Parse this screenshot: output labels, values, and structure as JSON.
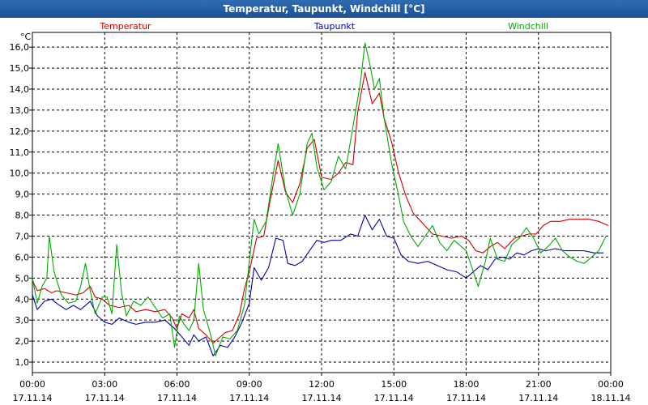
{
  "window": {
    "title": "Temperatur, Taupunkt, Windchill [°C]"
  },
  "chart_data": {
    "type": "line",
    "title": "Temperatur, Taupunkt, Windchill [°C]",
    "ylabel": "°C",
    "ylim": [
      0.5,
      16.7
    ],
    "yticks": [
      "1,0",
      "2,0",
      "3,0",
      "4,0",
      "5,0",
      "6,0",
      "7,0",
      "8,0",
      "9,0",
      "10,0",
      "11,0",
      "12,0",
      "13,0",
      "14,0",
      "15,0",
      "16,0"
    ],
    "ytick_values": [
      1,
      2,
      3,
      4,
      5,
      6,
      7,
      8,
      9,
      10,
      11,
      12,
      13,
      14,
      15,
      16
    ],
    "xlim": [
      0,
      24
    ],
    "xticks": [
      {
        "time": "00:00",
        "date": "17.11.14",
        "h": 0
      },
      {
        "time": "03:00",
        "date": "17.11.14",
        "h": 3
      },
      {
        "time": "06:00",
        "date": "17.11.14",
        "h": 6
      },
      {
        "time": "09:00",
        "date": "17.11.14",
        "h": 9
      },
      {
        "time": "12:00",
        "date": "17.11.14",
        "h": 12
      },
      {
        "time": "15:00",
        "date": "17.11.14",
        "h": 15
      },
      {
        "time": "18:00",
        "date": "17.11.14",
        "h": 18
      },
      {
        "time": "21:00",
        "date": "17.11.14",
        "h": 21
      },
      {
        "time": "00:00",
        "date": "18.11.14",
        "h": 24
      }
    ],
    "grid": true,
    "series": [
      {
        "name": "Temperatur",
        "color": "#cc0000",
        "points": [
          [
            0,
            4.9
          ],
          [
            0.2,
            4.4
          ],
          [
            0.5,
            4.5
          ],
          [
            0.8,
            4.3
          ],
          [
            1.0,
            4.4
          ],
          [
            1.4,
            4.3
          ],
          [
            1.8,
            4.2
          ],
          [
            2.1,
            4.3
          ],
          [
            2.4,
            4.6
          ],
          [
            2.6,
            4.1
          ],
          [
            2.9,
            4.0
          ],
          [
            3.2,
            3.7
          ],
          [
            3.6,
            3.6
          ],
          [
            4.0,
            3.7
          ],
          [
            4.3,
            3.4
          ],
          [
            4.7,
            3.5
          ],
          [
            5.1,
            3.4
          ],
          [
            5.5,
            3.5
          ],
          [
            5.8,
            3.1
          ],
          [
            6.0,
            2.6
          ],
          [
            6.2,
            3.3
          ],
          [
            6.5,
            3.1
          ],
          [
            6.7,
            3.5
          ],
          [
            6.9,
            2.6
          ],
          [
            7.2,
            2.3
          ],
          [
            7.5,
            1.9
          ],
          [
            7.7,
            2.1
          ],
          [
            8.0,
            2.4
          ],
          [
            8.3,
            2.5
          ],
          [
            8.6,
            3.3
          ],
          [
            8.8,
            4.5
          ],
          [
            9.0,
            5.3
          ],
          [
            9.3,
            6.9
          ],
          [
            9.6,
            7.0
          ],
          [
            9.9,
            8.9
          ],
          [
            10.2,
            10.6
          ],
          [
            10.5,
            9.1
          ],
          [
            10.8,
            8.6
          ],
          [
            11.1,
            9.5
          ],
          [
            11.4,
            11.2
          ],
          [
            11.7,
            11.6
          ],
          [
            12.0,
            9.8
          ],
          [
            12.4,
            9.7
          ],
          [
            12.7,
            10.0
          ],
          [
            13.0,
            10.5
          ],
          [
            13.3,
            10.4
          ],
          [
            13.5,
            12.9
          ],
          [
            13.8,
            14.8
          ],
          [
            14.1,
            13.3
          ],
          [
            14.4,
            13.8
          ],
          [
            14.6,
            12.6
          ],
          [
            14.9,
            11.5
          ],
          [
            15.2,
            10.0
          ],
          [
            15.5,
            8.9
          ],
          [
            15.8,
            8.1
          ],
          [
            16.2,
            7.6
          ],
          [
            16.6,
            7.1
          ],
          [
            17.0,
            7.0
          ],
          [
            17.4,
            6.9
          ],
          [
            17.8,
            7.0
          ],
          [
            18.1,
            6.8
          ],
          [
            18.4,
            6.3
          ],
          [
            18.7,
            6.2
          ],
          [
            19.0,
            6.5
          ],
          [
            19.3,
            6.7
          ],
          [
            19.6,
            6.4
          ],
          [
            20.0,
            6.9
          ],
          [
            20.3,
            7.0
          ],
          [
            20.6,
            7.1
          ],
          [
            20.9,
            7.1
          ],
          [
            21.2,
            7.5
          ],
          [
            21.5,
            7.7
          ],
          [
            21.9,
            7.7
          ],
          [
            22.3,
            7.8
          ],
          [
            22.7,
            7.8
          ],
          [
            23.1,
            7.8
          ],
          [
            23.5,
            7.7
          ],
          [
            23.9,
            7.5
          ]
        ]
      },
      {
        "name": "Taupunkt",
        "color": "#0000aa",
        "points": [
          [
            0,
            4.2
          ],
          [
            0.2,
            3.5
          ],
          [
            0.5,
            3.9
          ],
          [
            0.8,
            4.0
          ],
          [
            1.0,
            3.8
          ],
          [
            1.4,
            3.5
          ],
          [
            1.7,
            3.7
          ],
          [
            2.0,
            3.5
          ],
          [
            2.4,
            3.9
          ],
          [
            2.7,
            3.2
          ],
          [
            3.0,
            2.9
          ],
          [
            3.3,
            2.8
          ],
          [
            3.6,
            3.1
          ],
          [
            4.0,
            2.9
          ],
          [
            4.3,
            2.8
          ],
          [
            4.7,
            2.9
          ],
          [
            5.1,
            2.9
          ],
          [
            5.5,
            3.0
          ],
          [
            5.9,
            2.6
          ],
          [
            6.2,
            2.2
          ],
          [
            6.5,
            1.8
          ],
          [
            6.7,
            2.3
          ],
          [
            6.9,
            2.0
          ],
          [
            7.2,
            2.2
          ],
          [
            7.5,
            1.3
          ],
          [
            7.8,
            1.8
          ],
          [
            8.1,
            1.7
          ],
          [
            8.4,
            2.2
          ],
          [
            8.7,
            2.9
          ],
          [
            9.0,
            3.8
          ],
          [
            9.2,
            5.5
          ],
          [
            9.5,
            4.9
          ],
          [
            9.8,
            5.5
          ],
          [
            10.1,
            6.9
          ],
          [
            10.4,
            6.8
          ],
          [
            10.6,
            5.7
          ],
          [
            10.9,
            5.6
          ],
          [
            11.2,
            5.8
          ],
          [
            11.5,
            6.3
          ],
          [
            11.8,
            6.8
          ],
          [
            12.1,
            6.7
          ],
          [
            12.4,
            6.8
          ],
          [
            12.8,
            6.8
          ],
          [
            13.2,
            7.1
          ],
          [
            13.5,
            7.0
          ],
          [
            13.8,
            8.0
          ],
          [
            14.1,
            7.3
          ],
          [
            14.4,
            7.8
          ],
          [
            14.7,
            7.0
          ],
          [
            15.0,
            6.9
          ],
          [
            15.3,
            6.1
          ],
          [
            15.6,
            5.8
          ],
          [
            16.0,
            5.7
          ],
          [
            16.4,
            5.8
          ],
          [
            16.8,
            5.6
          ],
          [
            17.2,
            5.4
          ],
          [
            17.6,
            5.3
          ],
          [
            18.0,
            5.0
          ],
          [
            18.3,
            5.3
          ],
          [
            18.6,
            5.6
          ],
          [
            18.9,
            5.4
          ],
          [
            19.2,
            5.9
          ],
          [
            19.5,
            6.0
          ],
          [
            19.8,
            5.9
          ],
          [
            20.1,
            6.2
          ],
          [
            20.4,
            6.1
          ],
          [
            20.7,
            6.3
          ],
          [
            21.0,
            6.4
          ],
          [
            21.3,
            6.3
          ],
          [
            21.7,
            6.4
          ],
          [
            22.1,
            6.3
          ],
          [
            22.5,
            6.3
          ],
          [
            22.9,
            6.3
          ],
          [
            23.3,
            6.2
          ],
          [
            23.7,
            6.2
          ]
        ]
      },
      {
        "name": "Windchill",
        "color": "#00aa00",
        "points": [
          [
            0,
            5.0
          ],
          [
            0.2,
            3.8
          ],
          [
            0.4,
            4.6
          ],
          [
            0.6,
            5.0
          ],
          [
            0.7,
            7.0
          ],
          [
            0.9,
            5.3
          ],
          [
            1.2,
            4.2
          ],
          [
            1.5,
            3.8
          ],
          [
            1.8,
            3.9
          ],
          [
            2.0,
            4.6
          ],
          [
            2.2,
            5.7
          ],
          [
            2.4,
            4.4
          ],
          [
            2.6,
            3.3
          ],
          [
            2.9,
            4.1
          ],
          [
            3.1,
            4.1
          ],
          [
            3.3,
            3.3
          ],
          [
            3.5,
            6.6
          ],
          [
            3.7,
            4.3
          ],
          [
            3.9,
            3.2
          ],
          [
            4.2,
            3.9
          ],
          [
            4.5,
            3.7
          ],
          [
            4.8,
            4.1
          ],
          [
            5.1,
            3.6
          ],
          [
            5.4,
            3.1
          ],
          [
            5.7,
            3.3
          ],
          [
            5.9,
            1.7
          ],
          [
            6.1,
            3.2
          ],
          [
            6.3,
            2.8
          ],
          [
            6.5,
            2.5
          ],
          [
            6.7,
            3.0
          ],
          [
            6.9,
            5.7
          ],
          [
            7.1,
            3.5
          ],
          [
            7.4,
            2.3
          ],
          [
            7.6,
            1.3
          ],
          [
            7.9,
            2.2
          ],
          [
            8.2,
            2.1
          ],
          [
            8.5,
            2.5
          ],
          [
            8.8,
            3.7
          ],
          [
            9.0,
            5.8
          ],
          [
            9.2,
            7.8
          ],
          [
            9.4,
            7.1
          ],
          [
            9.7,
            7.7
          ],
          [
            10.0,
            10.0
          ],
          [
            10.2,
            11.4
          ],
          [
            10.5,
            9.2
          ],
          [
            10.8,
            8.0
          ],
          [
            11.1,
            9.0
          ],
          [
            11.4,
            11.4
          ],
          [
            11.6,
            11.9
          ],
          [
            11.8,
            10.3
          ],
          [
            12.1,
            9.2
          ],
          [
            12.4,
            9.6
          ],
          [
            12.7,
            10.8
          ],
          [
            13.0,
            10.2
          ],
          [
            13.3,
            12.2
          ],
          [
            13.6,
            14.2
          ],
          [
            13.8,
            16.2
          ],
          [
            14.0,
            15.2
          ],
          [
            14.2,
            14.0
          ],
          [
            14.4,
            14.5
          ],
          [
            14.6,
            12.6
          ],
          [
            14.9,
            10.5
          ],
          [
            15.2,
            8.9
          ],
          [
            15.4,
            7.7
          ],
          [
            15.7,
            7.0
          ],
          [
            16.0,
            6.5
          ],
          [
            16.3,
            7.0
          ],
          [
            16.6,
            7.5
          ],
          [
            16.9,
            6.7
          ],
          [
            17.2,
            6.3
          ],
          [
            17.5,
            6.8
          ],
          [
            17.8,
            6.5
          ],
          [
            18.0,
            6.3
          ],
          [
            18.3,
            5.3
          ],
          [
            18.5,
            4.6
          ],
          [
            18.8,
            5.8
          ],
          [
            19.0,
            6.9
          ],
          [
            19.3,
            5.9
          ],
          [
            19.6,
            5.8
          ],
          [
            19.9,
            6.6
          ],
          [
            20.2,
            6.9
          ],
          [
            20.5,
            7.4
          ],
          [
            20.8,
            6.9
          ],
          [
            21.1,
            6.2
          ],
          [
            21.4,
            6.5
          ],
          [
            21.7,
            6.9
          ],
          [
            22.0,
            6.3
          ],
          [
            22.3,
            6.0
          ],
          [
            22.6,
            5.8
          ],
          [
            22.9,
            5.7
          ],
          [
            23.2,
            6.0
          ],
          [
            23.5,
            6.3
          ],
          [
            23.8,
            7.0
          ]
        ]
      }
    ],
    "legend_placement": "top"
  }
}
